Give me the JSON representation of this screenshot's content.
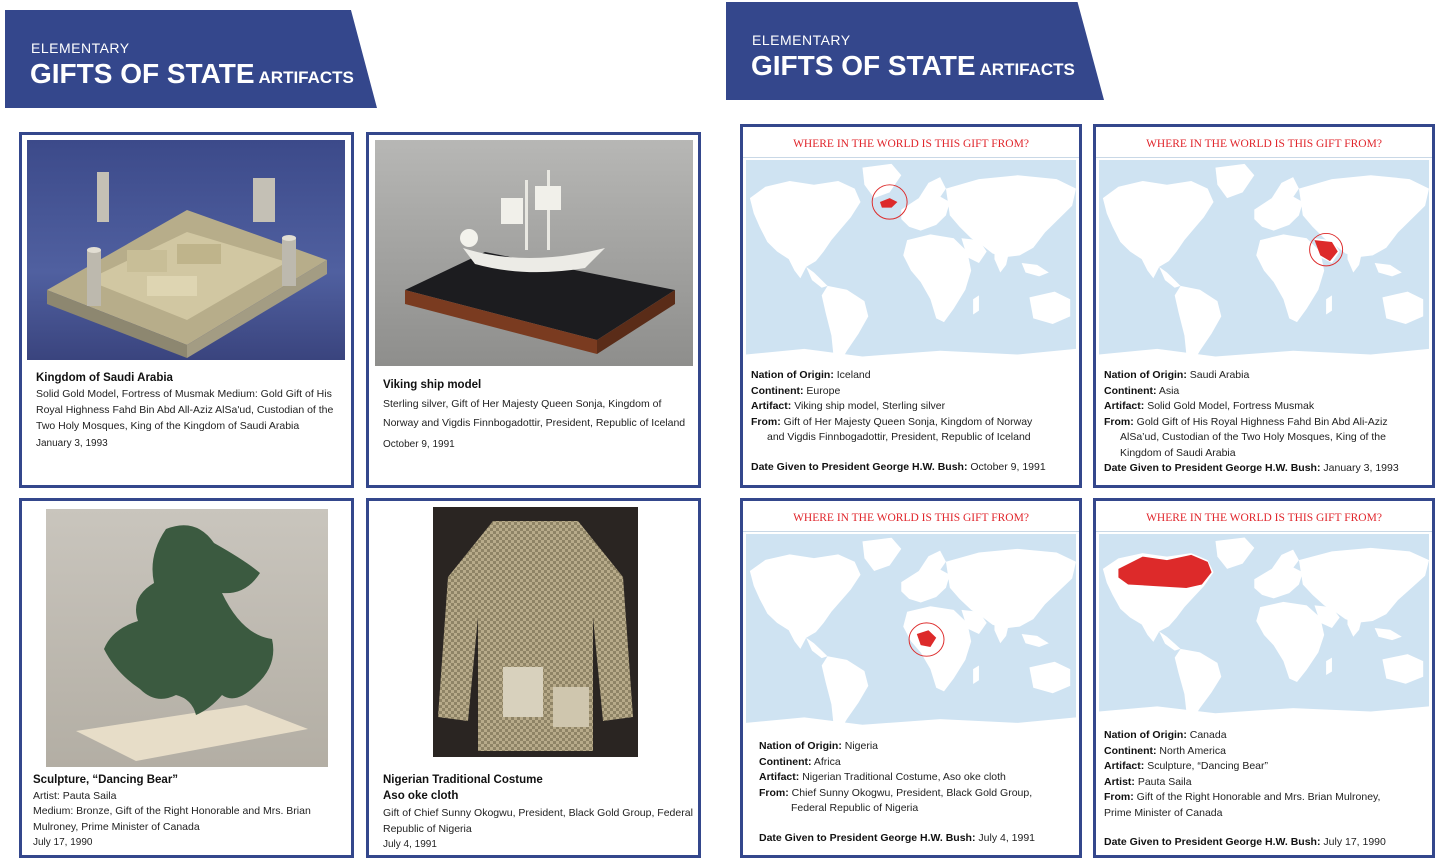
{
  "header": {
    "level": "ELEMENTARY",
    "title": "GIFTS OF STATE",
    "title_small": "ARTIFACTS"
  },
  "artifact_cards": [
    {
      "title": "Kingdom of Saudi Arabia",
      "body": "Solid Gold Model, Fortress of Musmak Medium: Gold Gift of His Royal Highness Fahd Bin Abd All-Aziz AlSa'ud, Custodian of the Two Holy Mosques, King of the Kingdom of Saudi Arabia",
      "date": "January 3, 1993"
    },
    {
      "title": "Viking ship model",
      "body": "Sterling silver, Gift of Her Majesty Queen Sonja, Kingdom of Norway and Vigdis Finnbogadottir, President, Republic of Iceland",
      "date": "October 9, 1991"
    },
    {
      "title": "Sculpture, “Dancing Bear”",
      "line1": "Artist: Pauta Saila",
      "body": "Medium: Bronze, Gift of the Right Honorable and Mrs. Brian Mulroney, Prime Minister of Canada",
      "date": "July 17, 1990"
    },
    {
      "title": "Nigerian Traditional Costume",
      "line1": "Aso oke cloth",
      "body": "Gift of Chief Sunny Okogwu, President, Black Gold Group, Federal Republic of Nigeria",
      "date": "July 4, 1991"
    }
  ],
  "map_question": "WHERE IN THE WORLD IS THIS GIFT FROM?",
  "labels": {
    "nation": "Nation of Origin:",
    "continent": "Continent:",
    "artifact": "Artifact:",
    "artist": "Artist:",
    "from": "From:",
    "date_given": "Date Given to President George H.W. Bush:"
  },
  "map_cards": [
    {
      "nation": "Iceland",
      "continent": "Europe",
      "artifact": "Viking ship model, Sterling silver",
      "from_1": "Gift of Her Majesty Queen Sonja, Kingdom of Norway",
      "from_2": "and Vigdis Finnbogadottir, President, Republic of Iceland",
      "date": "October 9, 1991"
    },
    {
      "nation": "Saudi Arabia",
      "continent": "Asia",
      "artifact": "Solid Gold Model, Fortress Musmak",
      "from_1": "Gold Gift of His Royal Highness Fahd Bin Abd Ali-Aziz",
      "from_2": "AlSa’ud, Custodian of the Two Holy Mosques, King of the",
      "from_3": "Kingdom of Saudi Arabia",
      "date": "January 3, 1993"
    },
    {
      "nation": "Nigeria",
      "continent": "Africa",
      "artifact": "Nigerian Traditional Costume, Aso oke cloth",
      "from_1": "Chief Sunny Okogwu, President, Black Gold Group,",
      "from_2": "Federal Republic of Nigeria",
      "date": "July 4, 1991"
    },
    {
      "nation": "Canada",
      "continent": "North America",
      "artifact": "Sculpture, “Dancing Bear”",
      "artist": "Pauta Saila",
      "from_1": "Gift of the Right Honorable and Mrs. Brian Mulroney,",
      "from_2": "Prime Minister of Canada",
      "date": "July 17, 1990"
    }
  ],
  "colors": {
    "banner": "#34478c",
    "ocean": "#cfe3f2",
    "land": "#ffffff",
    "highlight": "#dd2a2a",
    "question": "#e0252b"
  }
}
